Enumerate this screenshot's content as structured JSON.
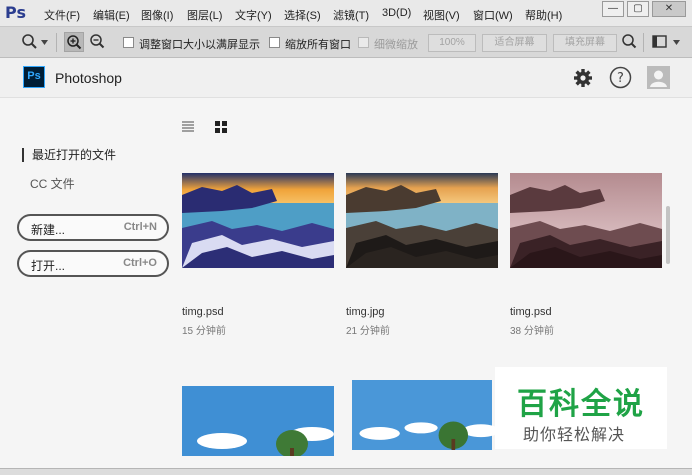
{
  "app": {
    "logo": "Ps",
    "name": "Photoshop"
  },
  "menu": [
    "文件(F)",
    "编辑(E)",
    "图像(I)",
    "图层(L)",
    "文字(Y)",
    "选择(S)",
    "滤镜(T)",
    "3D(D)",
    "视图(V)",
    "窗口(W)",
    "帮助(H)"
  ],
  "window_controls": {
    "minimize": "—",
    "maximize": "▢",
    "close": "✕"
  },
  "options": {
    "resize_windows": "调整窗口大小以满屏显示",
    "zoom_all": "缩放所有窗口",
    "scrubby_zoom": "细微缩放",
    "zoom_100": "100%",
    "fit_screen": "适合屏幕",
    "fill_screen": "填充屏幕"
  },
  "sidebar": {
    "recent": "最近打开的文件",
    "cc_files": "CC 文件",
    "new_label": "新建...",
    "new_shortcut": "Ctrl+N",
    "open_label": "打开...",
    "open_shortcut": "Ctrl+O"
  },
  "files": [
    {
      "name": "timg.psd",
      "time": "15 分钟前"
    },
    {
      "name": "timg.jpg",
      "time": "21 分钟前"
    },
    {
      "name": "timg.psd",
      "time": "38 分钟前"
    }
  ],
  "watermark": {
    "title": "百科全说",
    "subtitle": "助你轻松解决"
  },
  "colors": {
    "brand": "#31a8ff",
    "watermark_green": "#1fa346"
  },
  "icons": [
    "zoom-tool-icon",
    "zoom-in-icon",
    "zoom-out-icon",
    "hand-icon",
    "panel-icon",
    "gear-icon",
    "help-icon",
    "user-icon",
    "list-view-icon",
    "grid-view-icon"
  ]
}
